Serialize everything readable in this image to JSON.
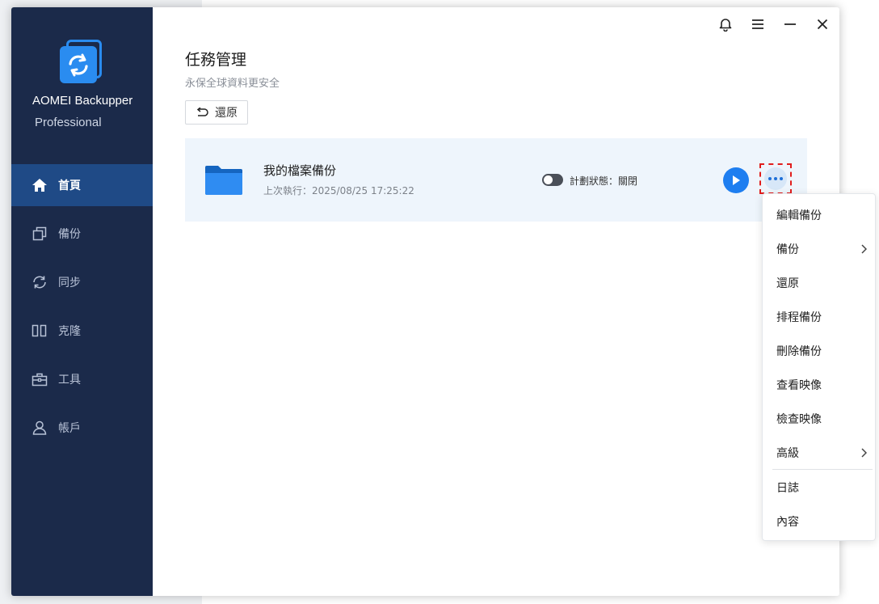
{
  "app": {
    "name": "AOMEI Backupper",
    "edition": "Professional"
  },
  "sidebar": {
    "items": [
      {
        "label": "首頁",
        "icon": "home-icon",
        "active": true
      },
      {
        "label": "備份",
        "icon": "backup-icon",
        "active": false
      },
      {
        "label": "同步",
        "icon": "sync-icon",
        "active": false
      },
      {
        "label": "克隆",
        "icon": "clone-icon",
        "active": false
      },
      {
        "label": "工具",
        "icon": "toolbox-icon",
        "active": false
      },
      {
        "label": "帳戶",
        "icon": "user-icon",
        "active": false
      }
    ]
  },
  "window_controls": [
    "bell-icon",
    "menu-icon",
    "minimize-icon",
    "close-icon"
  ],
  "main": {
    "title": "任務管理",
    "subtitle": "永保全球資料更安全",
    "restore_label": "還原"
  },
  "task": {
    "name": "我的檔案備份",
    "last_run": "上次執行：2025/08/25 17:25:22",
    "plan_status": "計劃狀態：關閉",
    "plan_enabled": false
  },
  "context_menu": {
    "items": [
      {
        "label": "編輯備份",
        "submenu": false
      },
      {
        "label": "備份",
        "submenu": true
      },
      {
        "label": "還原",
        "submenu": false
      },
      {
        "label": "排程備份",
        "submenu": false
      },
      {
        "label": "刪除備份",
        "submenu": false
      },
      {
        "label": "查看映像",
        "submenu": false
      },
      {
        "label": "檢查映像",
        "submenu": false
      },
      {
        "label": "高級",
        "submenu": true
      },
      {
        "label": "日誌",
        "submenu": false
      },
      {
        "label": "內容",
        "submenu": false
      }
    ]
  },
  "colors": {
    "sidebar_bg": "#1b2a4a",
    "sidebar_active": "#1f4a86",
    "accent": "#1e7ef0",
    "card_bg": "#eef5fc",
    "highlight_border": "#e11d1d"
  }
}
